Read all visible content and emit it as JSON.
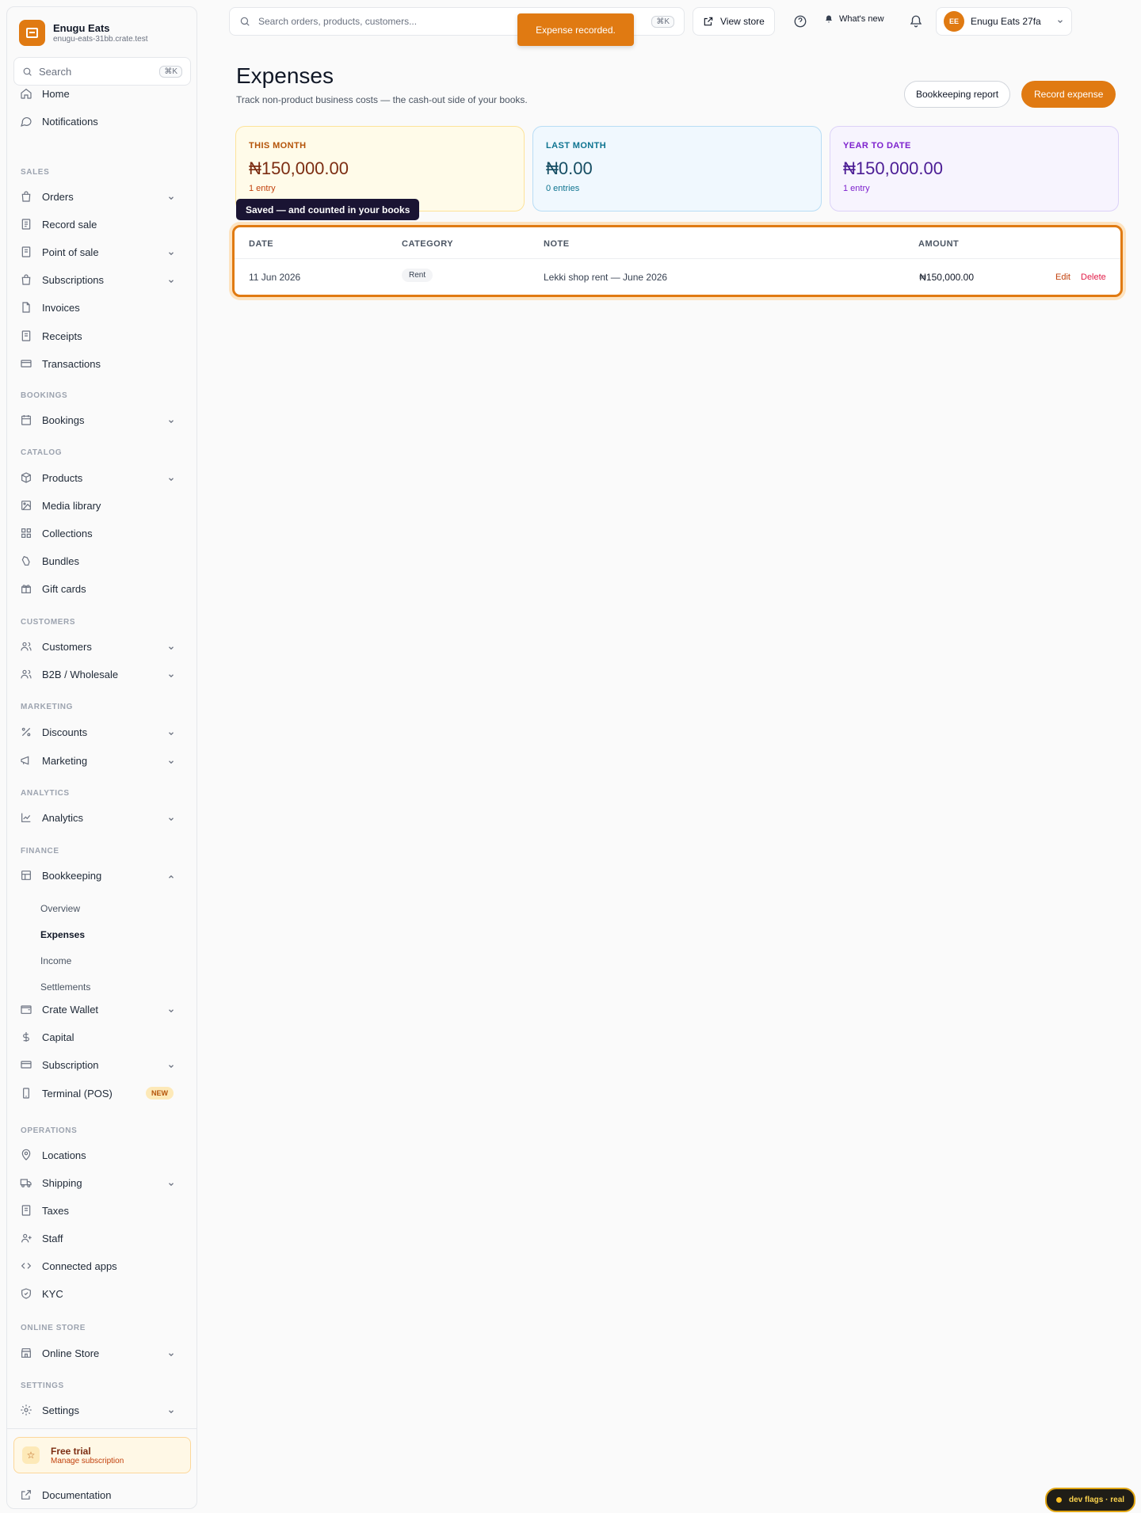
{
  "brand": {
    "name": "Enugu Eats",
    "domain": "enugu-eats-31bb.crate.test"
  },
  "sidebar_search": {
    "label": "Search",
    "shortcut": "⌘K"
  },
  "nav": {
    "home": "Home",
    "notifications": "Notifications",
    "sections": {
      "sales": "SALES",
      "bookings": "BOOKINGS",
      "catalog": "CATALOG",
      "customers": "CUSTOMERS",
      "marketing": "MARKETING",
      "analytics": "ANALYTICS",
      "finance": "FINANCE",
      "operations": "OPERATIONS",
      "online_store": "ONLINE STORE",
      "settings": "SETTINGS"
    },
    "items": {
      "orders": "Orders",
      "record_sale": "Record sale",
      "point_of_sale": "Point of sale",
      "subscriptions": "Subscriptions",
      "invoices": "Invoices",
      "receipts": "Receipts",
      "transactions": "Transactions",
      "bookings": "Bookings",
      "products": "Products",
      "media_library": "Media library",
      "collections": "Collections",
      "bundles": "Bundles",
      "gift_cards": "Gift cards",
      "customers": "Customers",
      "b2b": "B2B / Wholesale",
      "discounts": "Discounts",
      "marketing": "Marketing",
      "analytics": "Analytics",
      "bookkeeping": "Bookkeeping",
      "crate_wallet": "Crate Wallet",
      "capital": "Capital",
      "subscription": "Subscription",
      "terminal": "Terminal (POS)",
      "locations": "Locations",
      "shipping": "Shipping",
      "taxes": "Taxes",
      "staff": "Staff",
      "connected_apps": "Connected apps",
      "kyc": "KYC",
      "online_store": "Online Store",
      "settings": "Settings",
      "documentation": "Documentation"
    },
    "bookkeeping_sub": {
      "overview": "Overview",
      "expenses": "Expenses",
      "income": "Income",
      "settlements": "Settlements"
    },
    "terminal_badge": "NEW"
  },
  "trial": {
    "title": "Free trial",
    "subtitle": "Manage subscription"
  },
  "topbar": {
    "search_placeholder": "Search orders, products, customers...",
    "search_shortcut": "⌘K",
    "view_store": "View store",
    "whats_new": "What's new",
    "account_initials": "EE",
    "account_name": "Enugu Eats 27fa"
  },
  "toast": "Expense recorded.",
  "page": {
    "title": "Expenses",
    "subtitle": "Track non-product business costs — the cash-out side of your books.",
    "report_button": "Bookkeeping report",
    "record_button": "Record expense"
  },
  "summary": [
    {
      "label": "THIS MONTH",
      "amount": "₦150,000.00",
      "count": "1 entry"
    },
    {
      "label": "LAST MONTH",
      "amount": "₦0.00",
      "count": "0 entries"
    },
    {
      "label": "YEAR TO DATE",
      "amount": "₦150,000.00",
      "count": "1 entry"
    }
  ],
  "tooltip": "Saved — and counted in your books",
  "table": {
    "headers": {
      "date": "DATE",
      "category": "CATEGORY",
      "note": "NOTE",
      "amount": "AMOUNT"
    },
    "rows": [
      {
        "date": "11 Jun 2026",
        "category": "Rent",
        "note": "Lekki shop rent — June 2026",
        "amount": "₦150,000.00",
        "edit": "Edit",
        "delete": "Delete"
      }
    ]
  },
  "dev_flags": "dev flags · real",
  "colors": {
    "accent": "#e07a12",
    "delete": "#e11d48"
  }
}
